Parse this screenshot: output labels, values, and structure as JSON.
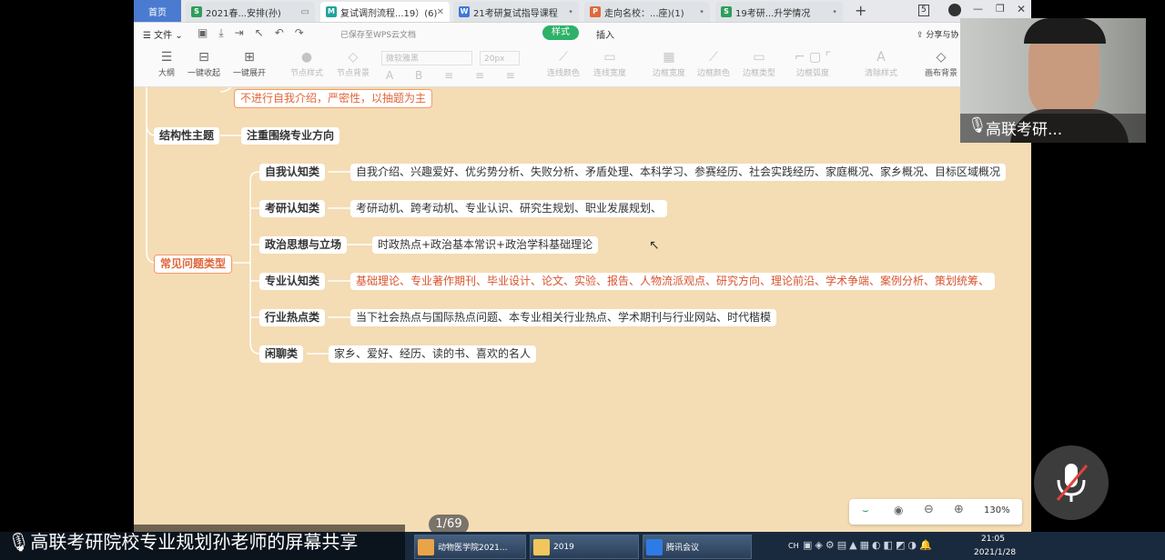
{
  "tabs": [
    {
      "label": "首页"
    },
    {
      "label": "2021春...安排(孙)",
      "icon": "S",
      "color": "#2e9e5b"
    },
    {
      "label": "复试调剂流程...19）(6)",
      "icon": "M",
      "color": "#1fa39b"
    },
    {
      "label": "21考研复试指导课程",
      "icon": "W",
      "color": "#3f78d6"
    },
    {
      "label": "走向名校：...座)(1)",
      "icon": "P",
      "color": "#e0683a"
    },
    {
      "label": "19考研...升学情况",
      "icon": "S",
      "color": "#2e9e5b"
    }
  ],
  "window": {
    "tab_count": "5"
  },
  "menubar": {
    "file": "文件",
    "saved": "已保存至WPS云文档",
    "style_btn": "样式",
    "insert": "插入",
    "share": "分享与协"
  },
  "ribbon": {
    "outline": "大纲",
    "collapse": "一键收起",
    "expand": "一键展开",
    "node_style": "节点样式",
    "node_bg": "节点背景",
    "font": "微软雅黑",
    "size": "20px",
    "line_color": "连线颜色",
    "line_width": "连线宽度",
    "border_width": "边框宽度",
    "border_color": "边框颜色",
    "border_type": "边框类型",
    "border_radius": "边框弧度",
    "clear_style": "清除样式",
    "canvas_bg": "画布背景"
  },
  "mindmap": {
    "top_note": "不进行自我介绍，严密性，以抽题为主",
    "structural": "结构性主题",
    "structural_child": "注重围绕专业方向",
    "common": "常见问题类型",
    "cats": [
      {
        "label": "自我认知类",
        "detail": "自我介绍、兴趣爱好、优劣势分析、失败分析、矛盾处理、本科学习、参赛经历、社会实践经历、家庭概况、家乡概况、目标区域概况"
      },
      {
        "label": "考研认知类",
        "detail": "考研动机、跨考动机、专业认识、研究生规划、职业发展规划、"
      },
      {
        "label": "政治思想与立场",
        "detail": "时政热点+政治基本常识+政治学科基础理论"
      },
      {
        "label": "专业认知类",
        "detail": "基础理论、专业著作期刊、毕业设计、论文、实验、报告、人物流派观点、研究方向、理论前沿、学术争端、案例分析、策划统筹、"
      },
      {
        "label": "行业热点类",
        "detail": "当下社会热点与国际热点问题、本专业相关行业热点、学术期刊与行业网站、时代楷模"
      },
      {
        "label": "闲聊类",
        "detail": "家乡、爱好、经历、读的书、喜欢的名人"
      }
    ]
  },
  "zoom": {
    "value": "130%"
  },
  "page_indicator": "1/69",
  "camera": {
    "name": "高联考研..."
  },
  "caption": "高联考研院校专业规划孙老师的屏幕共享",
  "taskbar": {
    "task1": "动物医学院2021...",
    "task2": "2019",
    "task3": "腾讯会议",
    "lang": "CH",
    "time": "21:05",
    "date": "2021/1/28"
  }
}
